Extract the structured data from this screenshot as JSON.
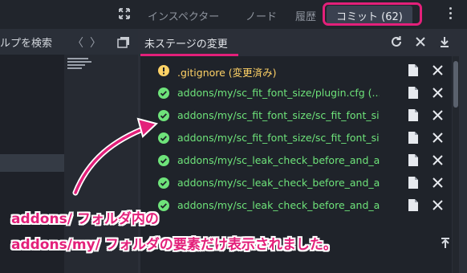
{
  "left": {
    "search_text": "ルプを検索",
    "nav_prev": "〈",
    "nav_next": "〉"
  },
  "tabs": [
    {
      "label": "インスペクター",
      "active": false
    },
    {
      "label": "ノード",
      "active": false
    },
    {
      "label": "履歴",
      "active": false
    },
    {
      "label": "コミット (62)",
      "active": true
    }
  ],
  "panel": {
    "title": "未ステージの変更"
  },
  "files": [
    {
      "name": ".gitignore (変更済み)",
      "status": "modified"
    },
    {
      "name": "addons/my/sc_fit_font_size/plugin.cfg (...",
      "status": "new"
    },
    {
      "name": "addons/my/sc_fit_font_size/sc_fit_font_si...",
      "status": "new"
    },
    {
      "name": "addons/my/sc_fit_font_size/sc_fit_font_si...",
      "status": "new"
    },
    {
      "name": "addons/my/sc_leak_check_before_and_a...",
      "status": "new"
    },
    {
      "name": "addons/my/sc_leak_check_before_and_a...",
      "status": "new"
    },
    {
      "name": "addons/my/sc_leak_check_before_and_a...",
      "status": "new"
    }
  ],
  "annotation": {
    "line1": "addons/ フォルダ内の",
    "line2": "addons/my/ フォルダの要素だけ表示されました。"
  },
  "colors": {
    "accent_pink": "#e3207a",
    "added_green": "#6ee37a",
    "modified_yellow": "#ffd266"
  }
}
